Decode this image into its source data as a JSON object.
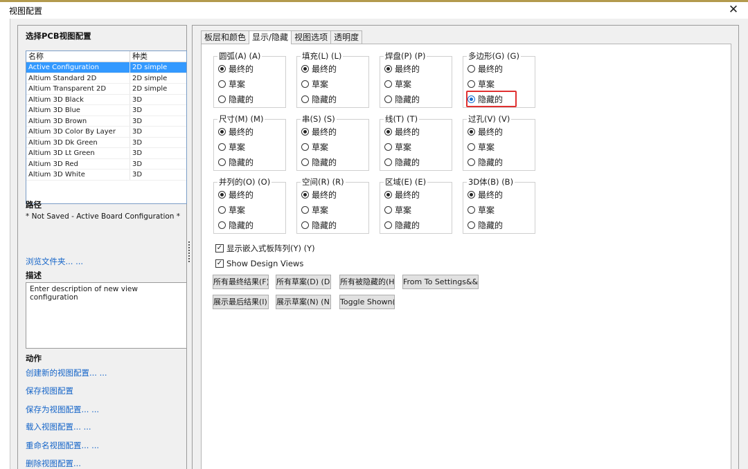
{
  "window": {
    "title": "视图配置",
    "close_glyph": "✕"
  },
  "left": {
    "select_title": "选择PCB视图配置",
    "list_headers": {
      "name": "名称",
      "type": "种类"
    },
    "configs": [
      {
        "name": "Active Configuration",
        "type": "2D simple"
      },
      {
        "name": "Altium Standard 2D",
        "type": "2D simple"
      },
      {
        "name": "Altium Transparent 2D",
        "type": "2D simple"
      },
      {
        "name": "Altium 3D Black",
        "type": "3D"
      },
      {
        "name": "Altium 3D Blue",
        "type": "3D"
      },
      {
        "name": "Altium 3D Brown",
        "type": "3D"
      },
      {
        "name": "Altium 3D Color By Layer",
        "type": "3D"
      },
      {
        "name": "Altium 3D Dk Green",
        "type": "3D"
      },
      {
        "name": "Altium 3D Lt Green",
        "type": "3D"
      },
      {
        "name": "Altium 3D Red",
        "type": "3D"
      },
      {
        "name": "Altium 3D White",
        "type": "3D"
      }
    ],
    "path_title": "路径",
    "path_value": "* Not Saved - Active Board Configuration *",
    "browse_link": "浏览文件夹... ...",
    "desc_title": "描述",
    "desc_value": "Enter description of new view configuration",
    "actions_title": "动作",
    "actions": [
      "创建新的视图配置... ...",
      "保存视图配置",
      "保存为视图配置... ...",
      "载入视图配置... ...",
      "重命名视图配置... ...",
      "删除视图配置..."
    ]
  },
  "tabs": [
    "板层和颜色",
    "显示/隐藏",
    "视图选项",
    "透明度"
  ],
  "active_tab": "显示/隐藏",
  "option_labels": [
    "最终的",
    "草案",
    "隐藏的"
  ],
  "groups": [
    {
      "label": "圆弧(A) (A)",
      "selected": "最终的"
    },
    {
      "label": "填充(L) (L)",
      "selected": "最终的"
    },
    {
      "label": "焊盘(P) (P)",
      "selected": "最终的"
    },
    {
      "label": "多边形(G) (G)",
      "selected": "隐藏的"
    },
    {
      "label": "尺寸(M) (M)",
      "selected": "最终的"
    },
    {
      "label": "串(S) (S)",
      "selected": "最终的"
    },
    {
      "label": "线(T) (T)",
      "selected": "最终的"
    },
    {
      "label": "过孔(V) (V)",
      "selected": "最终的"
    },
    {
      "label": "并列的(O) (O)",
      "selected": "最终的"
    },
    {
      "label": "空间(R) (R)",
      "selected": "最终的"
    },
    {
      "label": "区域(E) (E)",
      "selected": "最终的"
    },
    {
      "label": "3D体(B) (B)",
      "selected": "最终的"
    }
  ],
  "checkboxes": [
    {
      "label": "显示嵌入式板阵列(Y) (Y)",
      "checked": true
    },
    {
      "label": "Show Design Views",
      "checked": true
    }
  ],
  "buttons_row1": [
    "所有最终结果(F) (",
    "所有草案(D) (D)",
    "所有被隐藏的(H) (",
    "From To Settings&&&..."
  ],
  "buttons_row2": [
    "展示最后结果(I) (",
    "展示草案(N) (N)",
    "Toggle Shown(W) ("
  ]
}
